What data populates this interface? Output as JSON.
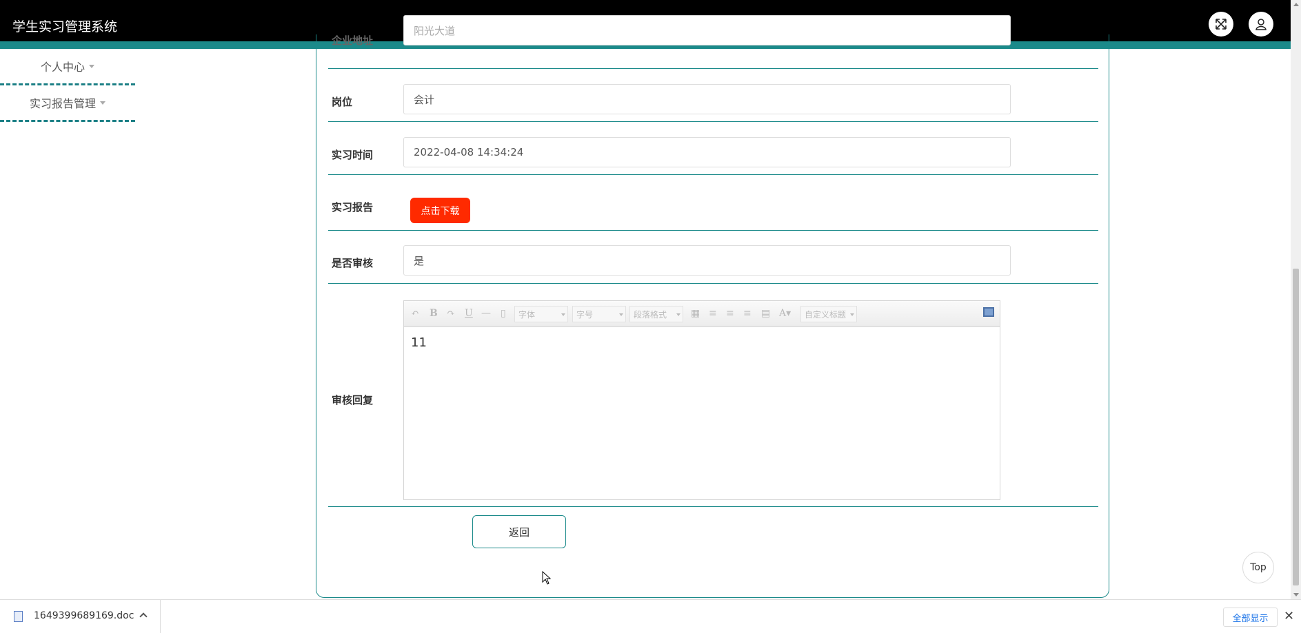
{
  "app": {
    "title": "学生实习管理系统"
  },
  "header": {
    "fullscreen_icon": "expand-icon",
    "user_icon": "user-icon"
  },
  "sidebar": {
    "items": [
      {
        "label": "个人中心"
      },
      {
        "label": "实习报告管理"
      }
    ]
  },
  "form": {
    "partial_row": {
      "label": "企业地址",
      "value": "阳光大道"
    },
    "position": {
      "label": "岗位",
      "value": "会计"
    },
    "time": {
      "label": "实习时间",
      "value": "2022-04-08 14:34:24"
    },
    "report": {
      "label": "实习报告",
      "button_label": "点击下载",
      "button_color": "#ff2a00"
    },
    "reviewed": {
      "label": "是否审核",
      "value": "是"
    },
    "reply": {
      "label": "审核回复",
      "toolbar": {
        "font_placeholder": "字体",
        "size_placeholder": "字号",
        "paragraph_placeholder": "段落格式",
        "custom_title_placeholder": "自定义标题"
      },
      "content": "11"
    },
    "back_label": "返回"
  },
  "top_button_label": "Top",
  "download_bar": {
    "file_name": "1649399689169.doc",
    "show_all_label": "全部显示"
  },
  "colors": {
    "accent": "#1b8a8a",
    "header_bg": "#000000",
    "download_button": "#ff2a00"
  }
}
